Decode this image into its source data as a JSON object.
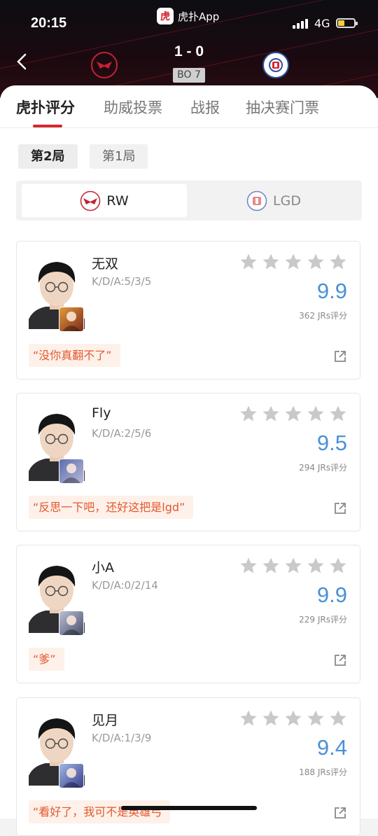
{
  "status_bar": {
    "time": "20:15",
    "app_name": "虎扑App",
    "app_logo_char": "虎",
    "network": "4G",
    "battery_percent": 30
  },
  "match": {
    "score": "1 - 0",
    "format": "BO 7",
    "home_team": "RW",
    "away_team": "LGD"
  },
  "tabs": [
    {
      "label": "虎扑评分",
      "active": true
    },
    {
      "label": "助威投票",
      "active": false
    },
    {
      "label": "战报",
      "active": false
    },
    {
      "label": "抽决赛门票",
      "active": false
    }
  ],
  "games": [
    {
      "label": "第2局",
      "active": true
    },
    {
      "label": "第1局",
      "active": false
    }
  ],
  "team_switch": [
    {
      "label": "RW",
      "active": true
    },
    {
      "label": "LGD",
      "active": false
    }
  ],
  "players": [
    {
      "name": "无双",
      "kda": "K/D/A:5/3/5",
      "rating": "9.9",
      "votes": "362 JRs评分",
      "quote": "“没你真翻不了”"
    },
    {
      "name": "Fly",
      "kda": "K/D/A:2/5/6",
      "rating": "9.5",
      "votes": "294 JRs评分",
      "quote": "“反思一下吧，还好这把是lgd”"
    },
    {
      "name": "小A",
      "kda": "K/D/A:0/2/14",
      "rating": "9.9",
      "votes": "229 JRs评分",
      "quote": "“爹”"
    },
    {
      "name": "见月",
      "kda": "K/D/A:1/3/9",
      "rating": "9.4",
      "votes": "188 JRs评分",
      "quote": "“看好了，我可不是英雄弓"
    }
  ],
  "colors": {
    "accent_red": "#d8262e",
    "rating_blue": "#4a90d9",
    "quote_orange": "#e2582e",
    "star_gray": "#c9c9cc"
  },
  "icons": {
    "back": "chevron-left-icon",
    "star": "star-icon",
    "share": "share-icon"
  }
}
